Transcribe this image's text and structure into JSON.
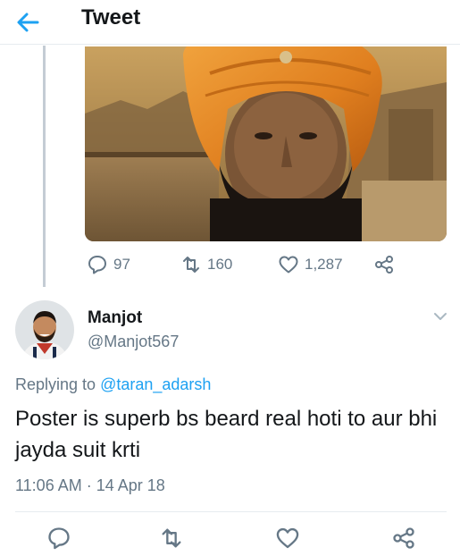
{
  "header": {
    "title": "Tweet",
    "back_icon": "back-arrow-icon",
    "accent_color": "#1da1f2"
  },
  "quoted_media": {
    "icon": "tweet-photo-turban-man"
  },
  "parent_actions": {
    "replies": "97",
    "retweets": "160",
    "likes": "1,287",
    "reply_icon": "reply-icon",
    "retweet_icon": "retweet-icon",
    "like_icon": "heart-icon",
    "share_icon": "share-icon"
  },
  "tweet": {
    "author_name": "Manjot",
    "author_handle": "@Manjot567",
    "replying_prefix": "Replying to ",
    "replying_to": "@taran_adarsh",
    "text": "Poster is superb bs beard real hoti to aur bhi jayda suit krti",
    "timestamp": "11:06 AM · 14 Apr 18"
  },
  "bottom_actions": {
    "reply_icon": "reply-icon",
    "retweet_icon": "retweet-icon",
    "like_icon": "heart-icon",
    "share_icon": "share-icon"
  },
  "colors": {
    "text": "#14171a",
    "muted": "#657786",
    "link": "#1da1f2",
    "divider": "#e6ecf0"
  }
}
